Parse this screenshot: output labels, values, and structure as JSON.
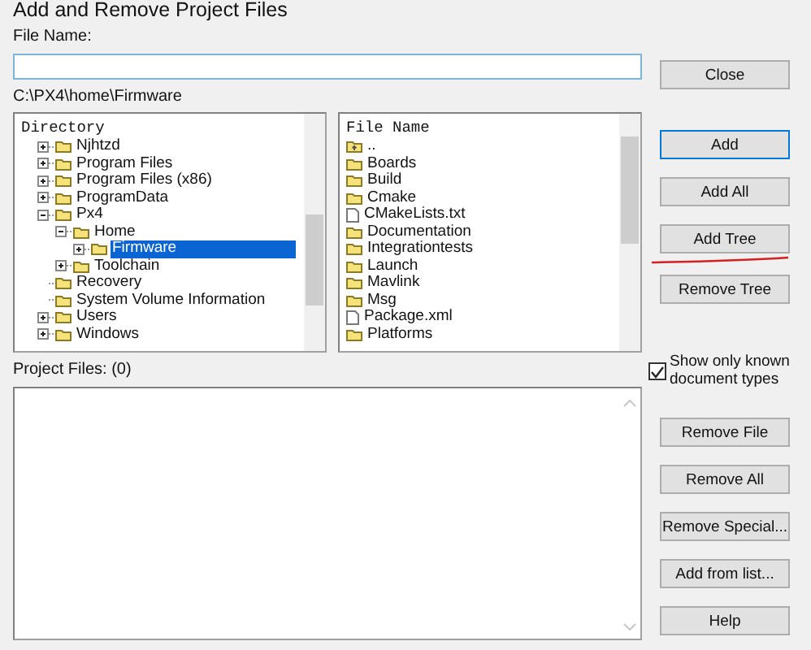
{
  "window": {
    "title": "Add and Remove Project Files"
  },
  "file_name": {
    "label": "File Name:"
  },
  "current_path": "C:\\PX4\\home\\Firmware",
  "directory": {
    "header": "Directory",
    "items": [
      {
        "name": "Njhtzd",
        "kind": "expandable",
        "expanded": false,
        "selected": false
      },
      {
        "name": "Program Files",
        "kind": "expandable",
        "expanded": false,
        "selected": false
      },
      {
        "name": "Program Files (x86)",
        "kind": "expandable",
        "expanded": false,
        "selected": false
      },
      {
        "name": "ProgramData",
        "kind": "expandable",
        "expanded": false,
        "selected": false
      },
      {
        "name": "Px4",
        "kind": "expandable",
        "expanded": true,
        "selected": false,
        "children": [
          {
            "name": "Home",
            "kind": "expandable",
            "expanded": true,
            "selected": false,
            "children": [
              {
                "name": "Firmware",
                "kind": "expandable",
                "expanded": false,
                "selected": true
              }
            ]
          },
          {
            "name": "Toolchain",
            "kind": "expandable",
            "expanded": false,
            "selected": false
          }
        ]
      },
      {
        "name": "Recovery",
        "kind": "plain",
        "selected": false
      },
      {
        "name": "System Volume Information",
        "kind": "plain",
        "selected": false
      },
      {
        "name": "Users",
        "kind": "expandable",
        "expanded": false,
        "selected": false
      },
      {
        "name": "Windows",
        "kind": "expandable",
        "expanded": false,
        "selected": false
      }
    ]
  },
  "files": {
    "header": "File Name",
    "items": [
      {
        "name": "..",
        "kind": "parent"
      },
      {
        "name": "Boards",
        "kind": "folder"
      },
      {
        "name": "Build",
        "kind": "folder"
      },
      {
        "name": "Cmake",
        "kind": "folder"
      },
      {
        "name": "CMakeLists.txt",
        "kind": "file"
      },
      {
        "name": "Documentation",
        "kind": "folder"
      },
      {
        "name": "Integrationtests",
        "kind": "folder"
      },
      {
        "name": "Launch",
        "kind": "folder"
      },
      {
        "name": "Mavlink",
        "kind": "folder"
      },
      {
        "name": "Msg",
        "kind": "folder"
      },
      {
        "name": "Package.xml",
        "kind": "file"
      },
      {
        "name": "Platforms",
        "kind": "folder"
      }
    ]
  },
  "project_files": {
    "label": "Project Files: (0)"
  },
  "close_button": {
    "label": "Close"
  },
  "add_buttons": [
    {
      "label": "Add",
      "focused": true,
      "underlined": false
    },
    {
      "label": "Add All",
      "focused": false,
      "underlined": false
    },
    {
      "label": "Add Tree",
      "focused": false,
      "underlined": true
    },
    {
      "label": "Remove Tree",
      "focused": false,
      "underlined": false
    }
  ],
  "known_types": {
    "label": "Show only known document types",
    "checked": true
  },
  "remove_buttons": [
    {
      "label": "Remove File"
    },
    {
      "label": "Remove All"
    },
    {
      "label": "Remove Special..."
    },
    {
      "label": "Add from list..."
    },
    {
      "label": "Help"
    }
  ]
}
